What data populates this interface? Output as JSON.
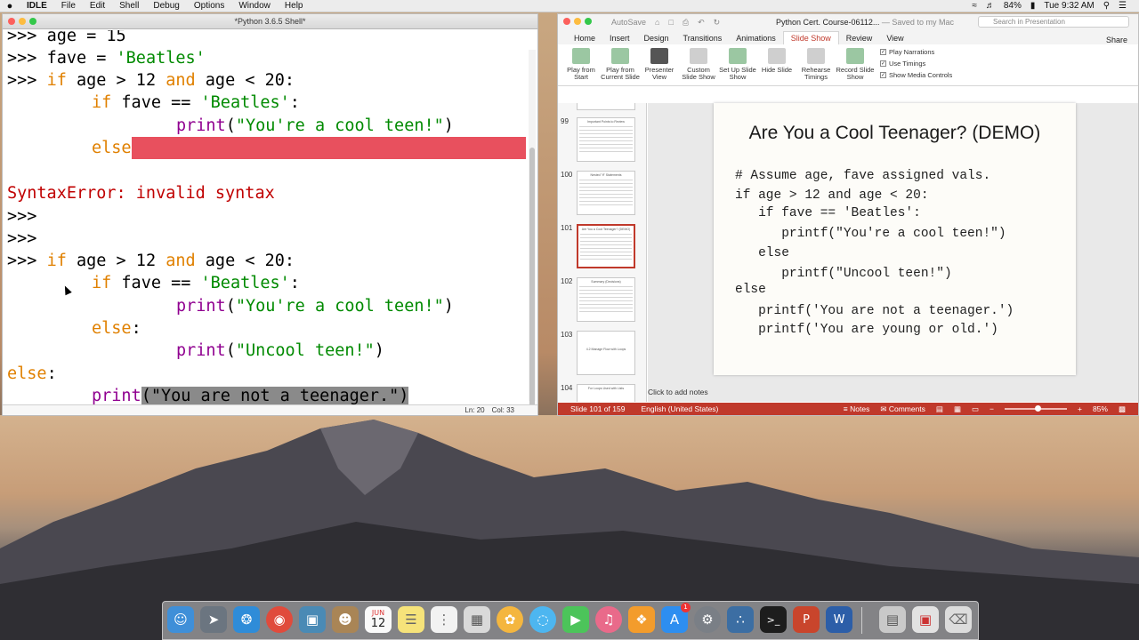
{
  "menubar": {
    "app": "IDLE",
    "items": [
      "File",
      "Edit",
      "Shell",
      "Debug",
      "Options",
      "Window",
      "Help"
    ],
    "battery": "84%",
    "clock": "Tue 9:32 AM"
  },
  "idle": {
    "title": "*Python 3.6.5 Shell*",
    "status_ln": "Ln: 20",
    "status_col": "Col: 33",
    "lines": {
      "l1_prompt": ">>> ",
      "l1_code": "age = 15",
      "l2_prompt": ">>> ",
      "l2_code": "fave = ",
      "l2_str": "'Beatles'",
      "l3_prompt": ">>> ",
      "l3_kw1": "if",
      "l3_mid": " age > 12 ",
      "l3_kw2": "and",
      "l3_end": " age < 20:",
      "l4_kw": "if",
      "l4_mid": " fave == ",
      "l4_str": "'Beatles'",
      "l4_end": ":",
      "l5_bi": "print",
      "l5_open": "(",
      "l5_str": "\"You're a cool teen!\"",
      "l5_close": ")",
      "l6_kw": "else",
      "l7_err": "SyntaxError: invalid syntax",
      "l8_prompt": ">>>",
      "l9_prompt": ">>>",
      "l10_prompt": ">>> ",
      "l10_kw1": "if",
      "l10_mid": " age > 12 ",
      "l10_kw2": "and",
      "l10_end": " age < 20:",
      "l11_kw": "if",
      "l11_mid": " fave == ",
      "l11_str": "'Beatles'",
      "l11_end": ":",
      "l12_bi": "print",
      "l12_open": "(",
      "l12_str": "\"You're a cool teen!\"",
      "l12_close": ")",
      "l13_kw": "else",
      "l13_end": ":",
      "l14_bi": "print",
      "l14_open": "(",
      "l14_str": "\"Uncool teen!\"",
      "l14_close": ")",
      "l15_kw": "else",
      "l15_end": ":",
      "l16_bi": "print",
      "l16_hl": "(\"You are not a teenager.\")"
    }
  },
  "ppt": {
    "autosave": "AutoSave",
    "doc_title": "Python Cert. Course-06112...",
    "saved": "— Saved to my Mac",
    "search_placeholder": "Search in Presentation",
    "tabs": [
      "Home",
      "Insert",
      "Design",
      "Transitions",
      "Animations",
      "Slide Show",
      "Review",
      "View"
    ],
    "active_tab": "Slide Show",
    "share": "Share",
    "ribbon": [
      {
        "label": "Play from Start"
      },
      {
        "label": "Play from Current Slide"
      },
      {
        "label": "Presenter View"
      },
      {
        "label": "Custom Slide Show"
      },
      {
        "label": "Set Up Slide Show"
      },
      {
        "label": "Hide Slide"
      },
      {
        "label": "Rehearse Timings"
      },
      {
        "label": "Record Slide Show"
      }
    ],
    "checks": [
      "Play Narrations",
      "Use Timings",
      "Show Media Controls"
    ],
    "thumbnails": [
      {
        "num": "99",
        "title": "Important Points to Review"
      },
      {
        "num": "100",
        "title": "Nested \"if\" Statements"
      },
      {
        "num": "101",
        "title": "Are You a Cool Teenager? (DEMO)"
      },
      {
        "num": "102",
        "title": "Summary (Decisions)"
      },
      {
        "num": "103",
        "title": "4.2 Manage Flow with Loops"
      },
      {
        "num": "104",
        "title": "For Loops Used with Lists"
      }
    ],
    "slide": {
      "title": "Are You a Cool Teenager? (DEMO)",
      "l1": "# Assume age, fave assigned vals.",
      "l2": "if age > 12 and age < 20:",
      "l3": "   if fave == 'Beatles':",
      "l4": "      printf(\"You're a cool teen!\")",
      "l5": "   else",
      "l6": "      printf(\"Uncool teen!\")",
      "l7": "else",
      "l8": "   printf('You are not a teenager.')",
      "l9": "   printf('You are young or old.')"
    },
    "notes": "Click to add notes",
    "status": {
      "slide": "Slide 101 of 159",
      "lang": "English (United States)",
      "notes": "Notes",
      "comments": "Comments",
      "zoom": "85%"
    }
  },
  "dock": {
    "badge": "1",
    "calendar_month": "JUN",
    "calendar_day": "12"
  },
  "colors": {
    "ppt_accent": "#c0392b",
    "idle_keyword": "#e08000",
    "idle_string": "#008a00",
    "idle_builtin": "#900090",
    "idle_error": "#c00000",
    "idle_error_highlight": "#e8505e"
  }
}
